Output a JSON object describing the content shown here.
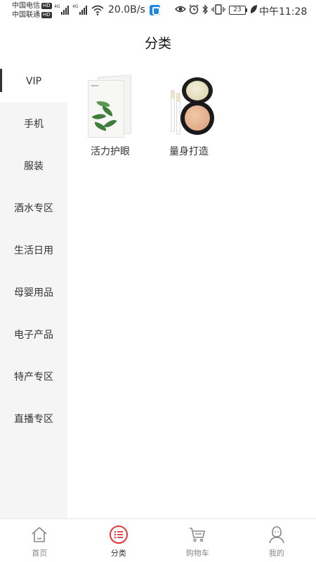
{
  "status_bar": {
    "carrier1": "中国电信",
    "carrier2": "中国联通",
    "hd_badge": "HD",
    "network1": "4G",
    "network2": "4G",
    "speed": "20.0B/s",
    "battery": "23",
    "time": "中午11:28",
    "icons": [
      "eye-icon",
      "alarm-icon",
      "bluetooth-icon",
      "vibrate-icon",
      "leaf-icon"
    ]
  },
  "header": {
    "title": "分类"
  },
  "sidebar": {
    "items": [
      {
        "label": "VIP",
        "active": true
      },
      {
        "label": "手机",
        "active": false
      },
      {
        "label": "服装",
        "active": false
      },
      {
        "label": "酒水专区",
        "active": false
      },
      {
        "label": "生活日用",
        "active": false
      },
      {
        "label": "母婴用品",
        "active": false
      },
      {
        "label": "电子产品",
        "active": false
      },
      {
        "label": "特产专区",
        "active": false
      },
      {
        "label": "直播专区",
        "active": false
      }
    ]
  },
  "content": {
    "products": [
      {
        "name": "活力护眼",
        "image": "eye-mask-pack-image"
      },
      {
        "name": "量身打造",
        "image": "cushion-compact-image"
      }
    ]
  },
  "bottom_nav": {
    "items": [
      {
        "label": "首页",
        "icon": "home-icon",
        "active": false
      },
      {
        "label": "分类",
        "icon": "category-icon",
        "active": true
      },
      {
        "label": "购物车",
        "icon": "cart-icon",
        "active": false
      },
      {
        "label": "我的",
        "icon": "profile-icon",
        "active": false
      }
    ]
  },
  "colors": {
    "accent": "#e0383e",
    "sidebar_bg": "#f5f5f5",
    "nav_inactive": "#888888"
  }
}
